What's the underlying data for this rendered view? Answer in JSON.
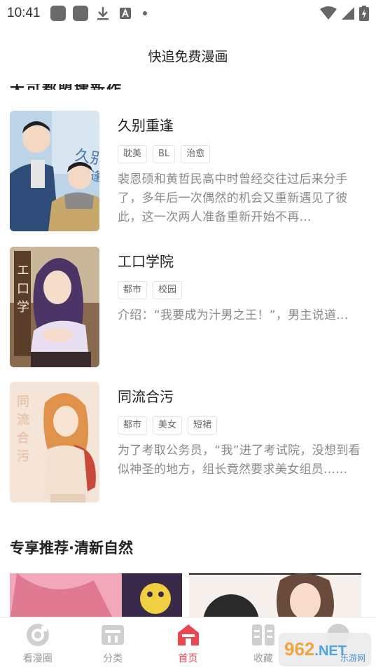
{
  "status": {
    "time": "10:41"
  },
  "header": {
    "title": "快追免费漫画"
  },
  "peek_heading": "大可都盟擂新作",
  "manga_list": [
    {
      "title": "久别重逢",
      "tags": [
        "耽美",
        "BL",
        "治愈"
      ],
      "desc": "裴恩硕和黄哲民高中时曾经交往过后来分手了，多年后一次偶然的机会又重新遇见了彼此，这一次两人准备重新开始不再…",
      "cover_text": "久别重逢"
    },
    {
      "title": "工口学院",
      "tags": [
        "都市",
        "校园"
      ],
      "desc": "介绍：“我要成为汁男之王！”，男主说道...",
      "cover_text": "工口学院"
    },
    {
      "title": "同流合污",
      "tags": [
        "都市",
        "美女",
        "短裙"
      ],
      "desc": "为了考取公务员，“我”进了考试院，没想到看似神圣的地方，组长竟然要求美女组员......",
      "cover_text": "同流合污"
    }
  ],
  "section": {
    "title": "专享推荐·清新自然"
  },
  "bottom_nav": [
    {
      "label": "看漫圈",
      "icon": "circle-logo-icon",
      "active": false
    },
    {
      "label": "分类",
      "icon": "category-icon",
      "active": false
    },
    {
      "label": "首页",
      "icon": "home-icon",
      "active": true
    },
    {
      "label": "收藏",
      "icon": "bookshelf-icon",
      "active": false
    },
    {
      "label": "",
      "icon": "profile-icon",
      "active": false
    }
  ],
  "watermark": {
    "num": "962",
    "net": ".NET",
    "sub": "乐游网"
  },
  "colors": {
    "accent": "#e8474f",
    "nav_inactive": "#999999"
  }
}
